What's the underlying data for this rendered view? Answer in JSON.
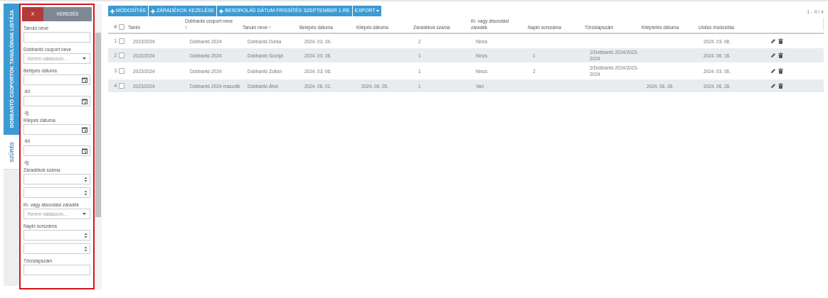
{
  "side_tabs": [
    {
      "label": "DOBBANTÓ CSOPORTOK TANULÓINAK LISTÁJA",
      "selected": true
    },
    {
      "label": "SZŰRÉS",
      "selected": false
    }
  ],
  "filter_panel": {
    "clear_button": "X",
    "search_button": "KERESÉS",
    "filters": [
      {
        "kind": "text",
        "label": "Tanuló neve"
      },
      {
        "kind": "select",
        "label": "Dobbantó csoport neve",
        "placeholder": "Kérem válasszon..."
      },
      {
        "kind": "date_range",
        "label": "Belépés dátuma",
        "from_label": "-tól",
        "to_label": "-ig"
      },
      {
        "kind": "date_range",
        "label": "Kilépés dátuma",
        "from_label": "-tól",
        "to_label": "-ig"
      },
      {
        "kind": "number_range",
        "label": "Záradékok száma"
      },
      {
        "kind": "select",
        "label": "Ki- vagy átsorolási záradék",
        "placeholder": "Kérem válasszon..."
      },
      {
        "kind": "number_range",
        "label": "Napló sorszáma"
      },
      {
        "kind": "text",
        "label": "Törzslapszám"
      }
    ]
  },
  "toolbar": [
    {
      "kind": "plus",
      "label": "MÓDOSÍTÁS"
    },
    {
      "kind": "plus",
      "label": "ZÁRADÉKOK KEZELÉSE"
    },
    {
      "kind": "plus",
      "label": "BESOROLÁS DÁTUM FRISSÍTÉS SZEPTEMBER 1-RE"
    },
    {
      "kind": "menu",
      "label": "EXPORT"
    }
  ],
  "pagination": "1 - 4 / 4",
  "table": {
    "select_all_checked": false,
    "columns": [
      {
        "label": "#"
      },
      {
        "label": "Tanév"
      },
      {
        "label": "Dobbantó csoport neve",
        "sort": "↑"
      },
      {
        "label": "Tanuló neve",
        "sort": "↑"
      },
      {
        "label": "Belépés dátuma"
      },
      {
        "label": "Kilépés dátuma"
      },
      {
        "label": "Záradékok száma"
      },
      {
        "label": "Ki- vagy átsorolási záradék"
      },
      {
        "label": "Napló sorszáma"
      },
      {
        "label": "Törzslapszám"
      },
      {
        "label": "Kiléptetés dátuma"
      },
      {
        "label": "Utolsó módosítás"
      }
    ],
    "rows": [
      {
        "checked": false,
        "cells": [
          "1",
          "2023/2024",
          "Dobbantó 2024",
          "Dobbantó Dorka",
          "2024. 03. 04.",
          "",
          "2",
          "Nincs",
          "",
          "",
          "",
          "2024. 03. 08."
        ]
      },
      {
        "checked": false,
        "cells": [
          "2",
          "2023/2024",
          "Dobbantó 2024",
          "Dobbantó Szonja",
          "2024. 03. 06.",
          "",
          "1",
          "Nincs",
          "1",
          "1/Dobbantó 2024/2023-2024",
          "",
          "2024. 06. 18."
        ]
      },
      {
        "checked": false,
        "cells": [
          "3",
          "2023/2024",
          "Dobbantó 2024",
          "Dobbantó Zoltán",
          "2024. 03. 06.",
          "",
          "1",
          "Nincs",
          "2",
          "2/Dobbantó 2024/2023-2024",
          "",
          "2024. 03. 06."
        ]
      },
      {
        "checked": false,
        "cells": [
          "4",
          "2023/2024",
          "Dobbantó 2024 második",
          "Dobbantó Ábel",
          "2024. 06. 01.",
          "2024. 06. 05.",
          "1",
          "Van",
          "",
          "",
          "2024. 06. 28.",
          "2024. 06. 28."
        ]
      }
    ]
  }
}
